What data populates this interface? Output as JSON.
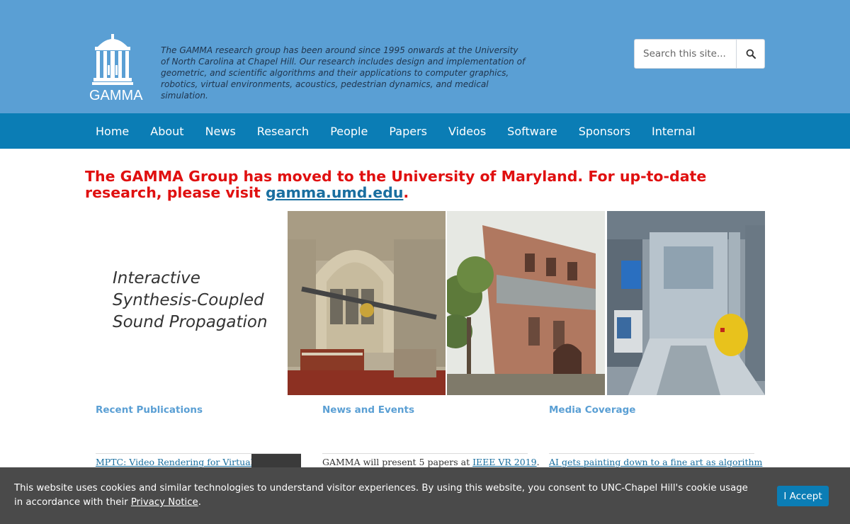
{
  "header": {
    "logo_text": "GAMMA",
    "tagline": "The GAMMA research group has been around since 1995 onwards at the University of North Carolina at Chapel Hill. Our research includes design and implementation of geometric, and scientific algorithms and their applications to computer graphics, robotics, virtual environments, acoustics, pedestrian dynamics, and medical simulation.",
    "search_placeholder": "Search this site...",
    "search_icon": "magnifier-icon"
  },
  "nav": {
    "items": [
      "Home",
      "About",
      "News",
      "Research",
      "People",
      "Papers",
      "Videos",
      "Software",
      "Sponsors",
      "Internal"
    ]
  },
  "notice": {
    "text_before": "The GAMMA Group has moved to the University of Maryland. For up-to-date research, please visit ",
    "link": "gamma.umd.edu",
    "text_after": "."
  },
  "hero": {
    "title_line1": "Interactive",
    "title_line2": "Synthesis-Coupled",
    "title_line3": "Sound Propagation"
  },
  "columns": {
    "publications": {
      "heading": "Recent Publications",
      "first_item": "MPTC: Video Rendering for Virtual"
    },
    "news": {
      "heading": "News and Events",
      "first_item_before": "GAMMA will present 5 papers at ",
      "first_item_link": "IEEE VR 2019",
      "first_item_after": "."
    },
    "media": {
      "heading": "Media Coverage",
      "first_item": "AI gets painting down to a fine art as algorithm"
    }
  },
  "cookie": {
    "text_before": "This website uses cookies and similar technologies to understand visitor experiences. By using this website, you consent to UNC-Chapel Hill's cookie usage in accordance with their ",
    "link": "Privacy Notice",
    "text_after": ".",
    "accept_label": "I Accept"
  },
  "colors": {
    "header_bg": "#5a9fd4",
    "nav_bg": "#0b7db5",
    "notice_red": "#e01010",
    "link_blue": "#1a6fa0",
    "cookie_bg": "#4a4a4a"
  }
}
